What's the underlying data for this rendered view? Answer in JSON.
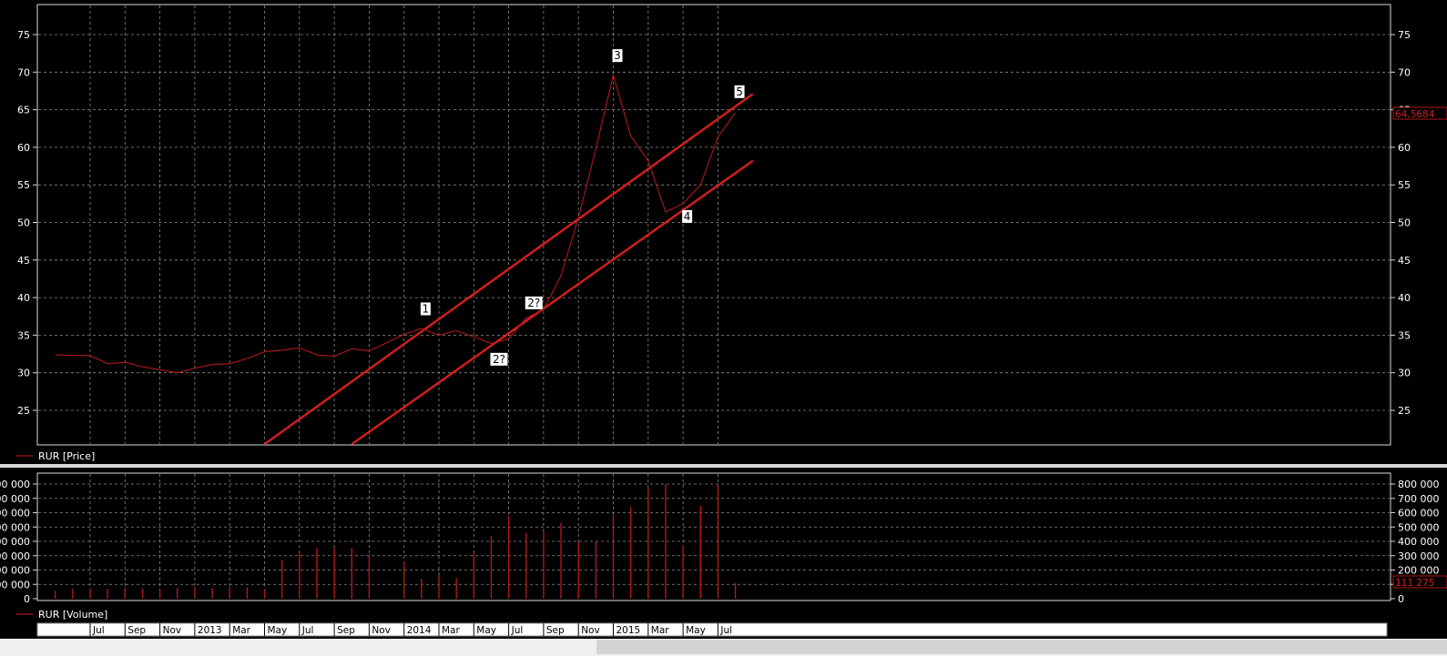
{
  "chart_data": [
    {
      "type": "line",
      "x_ticks": [
        "Jul",
        "Sep",
        "Nov",
        "2013",
        "Mar",
        "May",
        "Jul",
        "Sep",
        "Nov",
        "2014",
        "Mar",
        "May",
        "Jul",
        "Sep",
        "Nov",
        "2015",
        "Mar",
        "May",
        "Jul"
      ],
      "y_ticks": [
        "25",
        "30",
        "35",
        "40",
        "45",
        "50",
        "55",
        "60",
        "65",
        "70",
        "75"
      ],
      "ylim": [
        20,
        78
      ],
      "grid": true,
      "legend_position": "bottom-left",
      "series": [
        {
          "name": "RUR [Price]",
          "color": "#b01818",
          "x": [
            "2012-05",
            "2012-06",
            "2012-07",
            "2012-08",
            "2012-09",
            "2012-10",
            "2012-11",
            "2012-12",
            "2013-01",
            "2013-02",
            "2013-03",
            "2013-04",
            "2013-05",
            "2013-06",
            "2013-07",
            "2013-08",
            "2013-09",
            "2013-10",
            "2013-11",
            "2014-01",
            "2014-02",
            "2014-03",
            "2014-04",
            "2014-05",
            "2014-06",
            "2014-07",
            "2014-08",
            "2014-09",
            "2014-10",
            "2014-11",
            "2014-12",
            "2015-01",
            "2015-02",
            "2015-03",
            "2015-04",
            "2015-05",
            "2015-06",
            "2015-07",
            "2015-08"
          ],
          "y": [
            32.4,
            32.3,
            32.3,
            31.2,
            31.4,
            30.8,
            30.4,
            30.0,
            30.6,
            31.1,
            31.2,
            31.9,
            32.8,
            33.0,
            33.3,
            32.4,
            32.2,
            33.2,
            32.9,
            35.1,
            35.9,
            35.0,
            35.6,
            34.8,
            33.9,
            34.5,
            37.3,
            38.4,
            42.9,
            50.6,
            59.8,
            69.6,
            61.5,
            58.2,
            51.4,
            52.5,
            55.0,
            61.4,
            64.5684
          ]
        },
        {
          "name": "upper trendline",
          "color": "#d81e1e",
          "x": [
            "2013-05",
            "2015-09"
          ],
          "y": [
            20.5,
            67.1
          ]
        },
        {
          "name": "lower trendline",
          "color": "#d81e1e",
          "x": [
            "2013-10",
            "2015-09"
          ],
          "y": [
            20.5,
            58.2
          ]
        }
      ],
      "annotations": [
        {
          "text": "1",
          "x": "2014-02",
          "y": 38.5
        },
        {
          "text": "2?",
          "x": "2014-06",
          "y": 31.8
        },
        {
          "text": "2?",
          "x": "2014-08",
          "y": 39.3
        },
        {
          "text": "3",
          "x": "2015-01",
          "y": 72.2
        },
        {
          "text": "4",
          "x": "2015-05",
          "y": 50.8
        },
        {
          "text": "5",
          "x": "2015-08",
          "y": 67.4
        }
      ],
      "last_value_label": "64,5684"
    },
    {
      "type": "bar",
      "y_ticks": [
        "0",
        "100 000",
        "200 000",
        "300 000",
        "400 000",
        "500 000",
        "600 000",
        "700 000",
        "800 000"
      ],
      "ylim": [
        0,
        850000
      ],
      "grid": true,
      "legend_position": "bottom-left",
      "series": [
        {
          "name": "RUR [Volume]",
          "color": "#b01818",
          "x": [
            "2012-05",
            "2012-06",
            "2012-07",
            "2012-08",
            "2012-09",
            "2012-10",
            "2012-11",
            "2012-12",
            "2013-01",
            "2013-02",
            "2013-03",
            "2013-04",
            "2013-05",
            "2013-06",
            "2013-07",
            "2013-08",
            "2013-09",
            "2013-10",
            "2013-11",
            "2014-01",
            "2014-02",
            "2014-03",
            "2014-04",
            "2014-05",
            "2014-06",
            "2014-07",
            "2014-08",
            "2014-09",
            "2014-10",
            "2014-11",
            "2014-12",
            "2015-01",
            "2015-02",
            "2015-03",
            "2015-04",
            "2015-05",
            "2015-06",
            "2015-07",
            "2015-08"
          ],
          "values": [
            55000,
            70000,
            70000,
            70000,
            75000,
            70000,
            65000,
            75000,
            80000,
            75000,
            85000,
            80000,
            70000,
            270000,
            335000,
            355000,
            355000,
            355000,
            310000,
            255000,
            140000,
            165000,
            145000,
            320000,
            440000,
            575000,
            460000,
            470000,
            530000,
            400000,
            400000,
            580000,
            640000,
            775000,
            800000,
            370000,
            650000,
            790000,
            111275
          ]
        }
      ],
      "last_value_label": "111 275"
    }
  ]
}
